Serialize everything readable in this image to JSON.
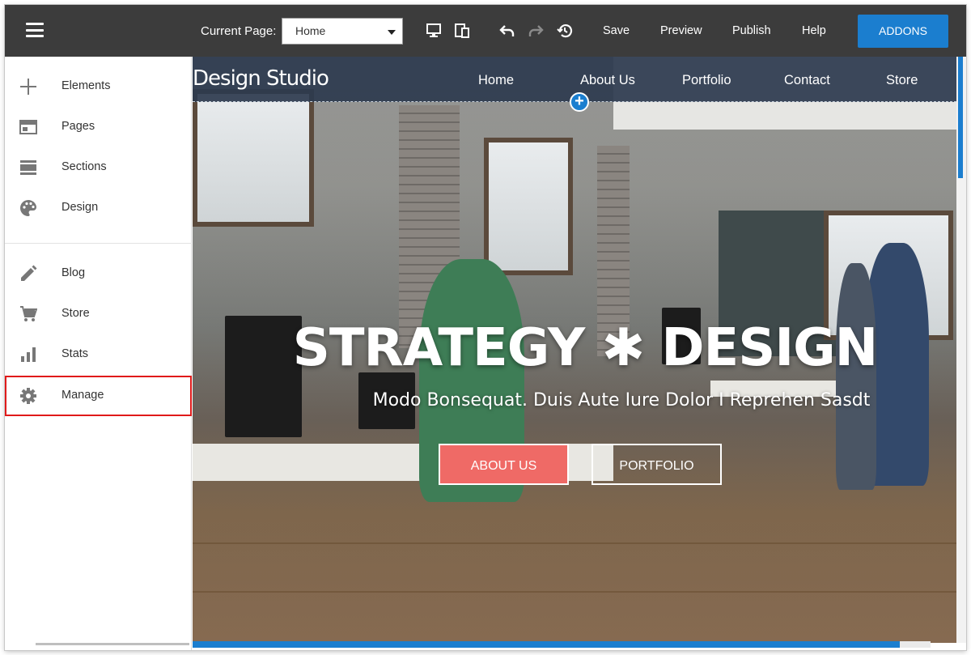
{
  "toolbar": {
    "current_page_label": "Current Page:",
    "current_page_value": "Home",
    "icons": [
      "menu-icon",
      "desktop-icon",
      "mobile-icon",
      "undo-icon",
      "redo-icon",
      "history-icon"
    ],
    "save_label": "Save",
    "preview_label": "Preview",
    "publish_label": "Publish",
    "help_label": "Help",
    "addons_label": "ADDONS",
    "addons_color": "#1b7ecf"
  },
  "sidebar": {
    "items": [
      {
        "label": "Elements",
        "icon": "plus-icon"
      },
      {
        "label": "Pages",
        "icon": "pages-icon"
      },
      {
        "label": "Sections",
        "icon": "sections-icon"
      },
      {
        "label": "Design",
        "icon": "palette-icon"
      },
      {
        "label": "Blog",
        "icon": "pencil-icon"
      },
      {
        "label": "Store",
        "icon": "cart-icon"
      },
      {
        "label": "Stats",
        "icon": "bar-chart-icon"
      },
      {
        "label": "Manage",
        "icon": "gear-icon",
        "highlighted": true
      }
    ],
    "highlight_color": "#e01a1a"
  },
  "site": {
    "logo": "Design Studio",
    "nav": [
      "Home",
      "About Us",
      "Portfolio",
      "Contact",
      "Store"
    ],
    "hero_title": "STRATEGY ✱ DESIGN",
    "hero_subtitle": "Modo Bonsequat. Duis Aute Iure Dolor I Reprehen Sasdt",
    "btn_about": "ABOUT US",
    "btn_portfolio": "PORTFOLIO",
    "btn_about_color": "#ef6a66",
    "nav_bg_color": "#2d3a4e"
  }
}
